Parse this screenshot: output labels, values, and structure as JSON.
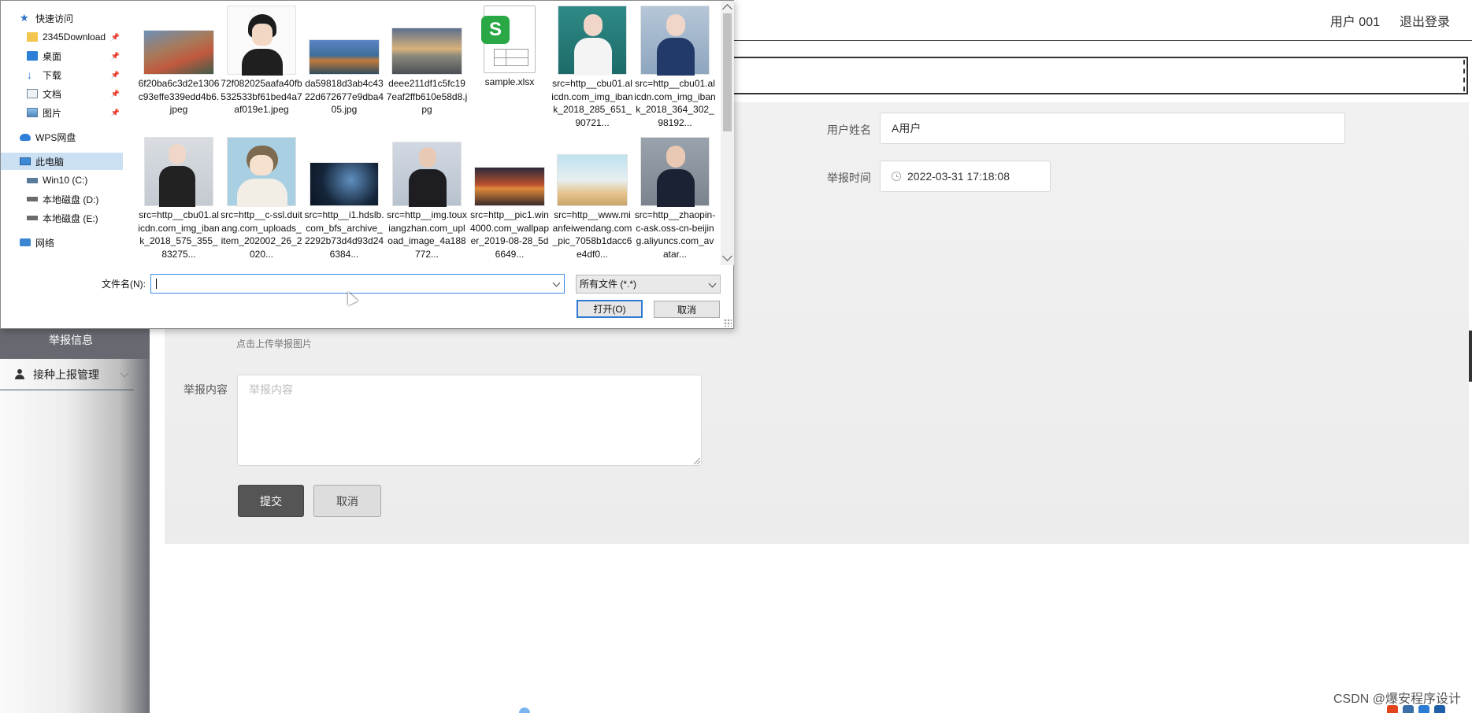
{
  "header": {
    "user_label": "用户 001",
    "logout_label": "退出登录"
  },
  "sidebar": {
    "active_item_label": "举报信息",
    "submenu_label": "接种上报管理"
  },
  "form": {
    "username_label": "用户姓名",
    "username_value": "A用户",
    "report_time_label": "举报时间",
    "report_time_value": "2022-03-31 17:18:08",
    "upload_hint": "点击上传举报图片",
    "content_label": "举报内容",
    "content_placeholder": "举报内容",
    "submit_label": "提交",
    "cancel_label": "取消"
  },
  "dialog": {
    "nav": {
      "quick_access": "快速访问",
      "items_pinned": [
        "2345Download",
        "桌面",
        "下载",
        "文档",
        "图片"
      ],
      "wps": "WPS网盘",
      "this_pc": "此电脑",
      "drives": [
        "Win10 (C:)",
        "本地磁盘 (D:)",
        "本地磁盘 (E:)"
      ],
      "network": "网络"
    },
    "files_row1": [
      {
        "name": "6f20ba6c3d2e1306c93effe339edd4b6.jpeg",
        "icon": "landscape-thumb"
      },
      {
        "name": "72f082025aafa40fb532533bf61bed4a7af019e1.jpeg",
        "icon": "avatar-thumb"
      },
      {
        "name": "da59818d3ab4c4322d672677e9dba405.jpg",
        "icon": "landscape-thumb"
      },
      {
        "name": "deee211df1c5fc197eaf2ffb610e58d8.jpg",
        "icon": "landscape-thumb"
      },
      {
        "name": "sample.xlsx",
        "icon": "spreadsheet-icon"
      },
      {
        "name": "src=http__cbu01.alicdn.com_img_ibank_2018_285_651_90721...",
        "icon": "portrait-thumb"
      },
      {
        "name": "src=http__cbu01.alicdn.com_img_ibank_2018_364_302_98192...",
        "icon": "portrait-thumb"
      }
    ],
    "files_row2": [
      {
        "name": "src=http__cbu01.alicdn.com_img_ibank_2018_575_355_83275...",
        "icon": "portrait-thumb"
      },
      {
        "name": "src=http__c-ssl.duitang.com_uploads_item_202002_26_2020...",
        "icon": "cartoon-thumb"
      },
      {
        "name": "src=http__i1.hdslb.com_bfs_archive_2292b73d4d93d246384...",
        "icon": "landscape-thumb"
      },
      {
        "name": "src=http__img.touxiangzhan.com_upload_image_4a188772...",
        "icon": "portrait-thumb"
      },
      {
        "name": "src=http__pic1.win4000.com_wallpaper_2019-08-28_5d6649...",
        "icon": "landscape-thumb"
      },
      {
        "name": "src=http__www.mianfeiwendang.com_pic_7058b1dacc6e4df0...",
        "icon": "landscape-thumb"
      },
      {
        "name": "src=http__zhaopin-c-ask.oss-cn-beijing.aliyuncs.com_avatar...",
        "icon": "portrait-thumb"
      }
    ],
    "filename_label": "文件名(N):",
    "filename_value": "",
    "file_type": "所有文件 (*.*)",
    "open_label": "打开(O)",
    "cancel_label": "取消"
  },
  "watermark": "CSDN @爆安程序设计",
  "colors": {
    "sidebar_active": "#666a70",
    "submit_button": "#555555",
    "dialog_focus": "#3a8be0",
    "nav_selected": "#cce0f3"
  }
}
